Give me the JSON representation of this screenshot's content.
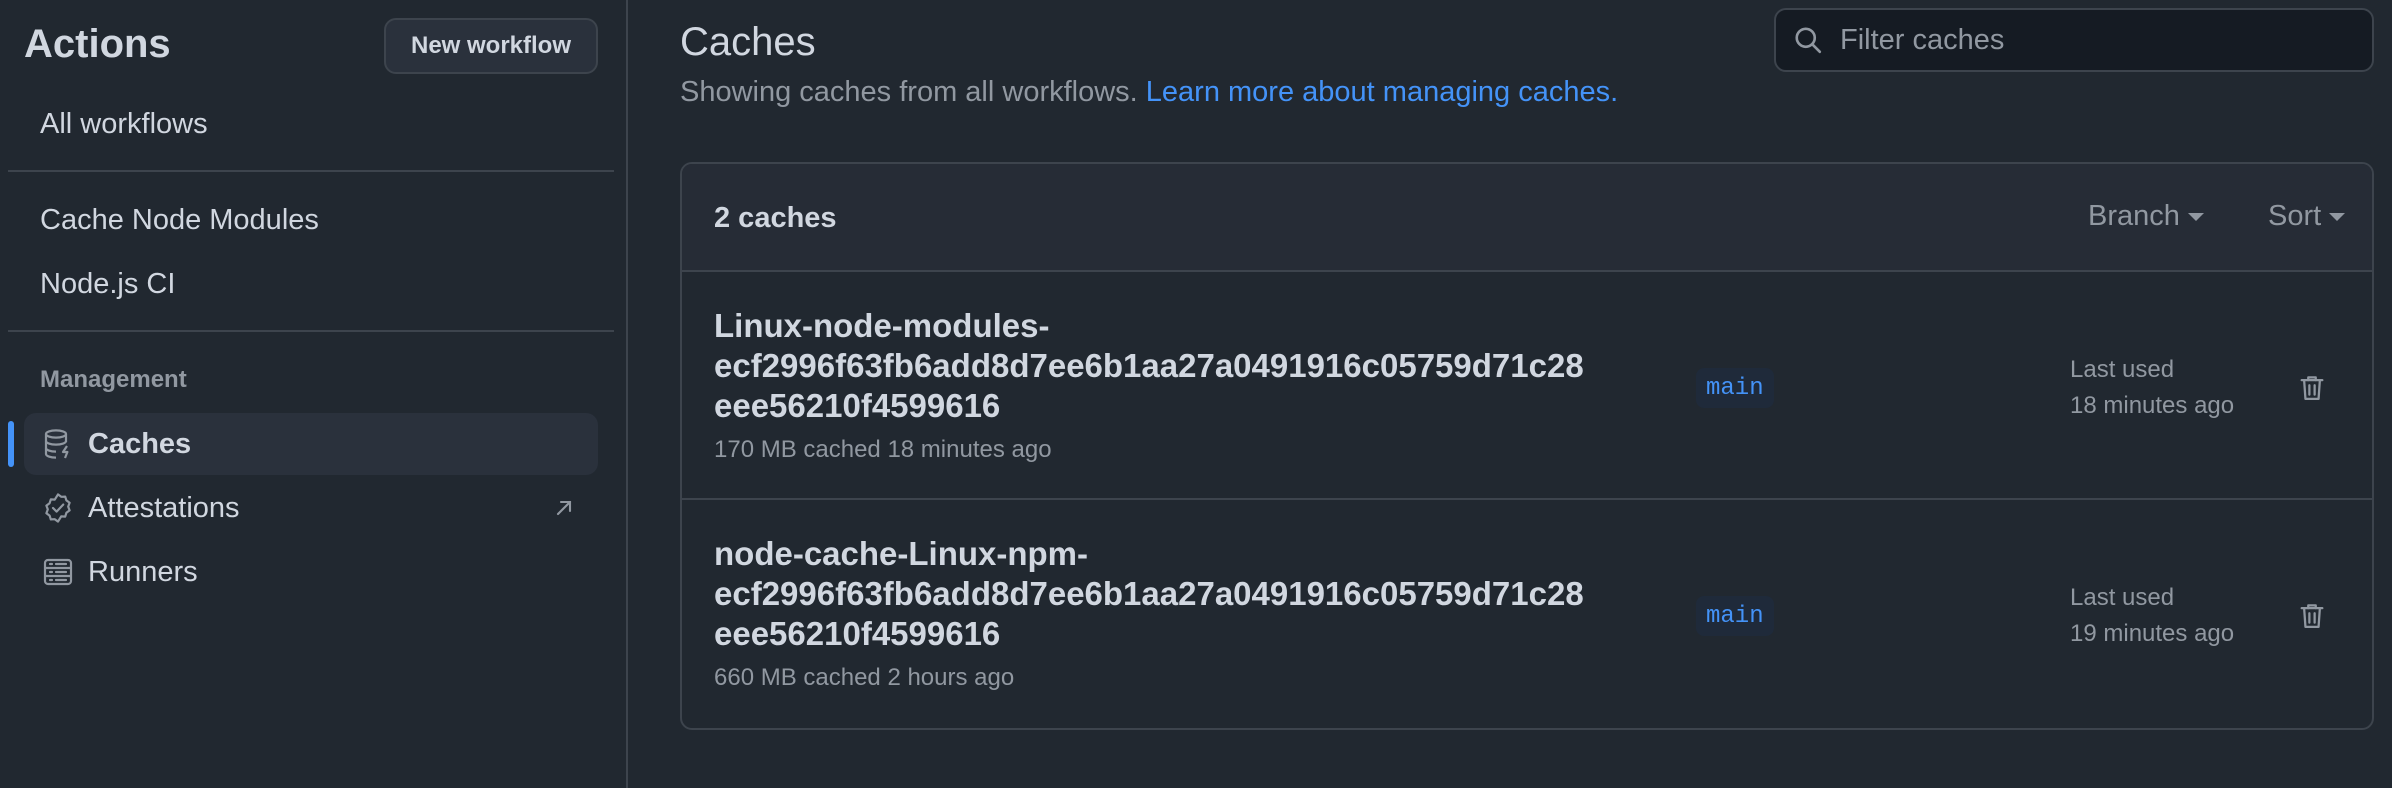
{
  "sidebar": {
    "title": "Actions",
    "new_workflow_label": "New workflow",
    "all_workflows": "All workflows",
    "workflows": [
      {
        "label": "Cache Node Modules"
      },
      {
        "label": "Node.js CI"
      }
    ],
    "management_label": "Management",
    "management_items": [
      {
        "label": "Caches",
        "icon": "database-icon",
        "active": true
      },
      {
        "label": "Attestations",
        "icon": "verified-icon",
        "external": true
      },
      {
        "label": "Runners",
        "icon": "server-icon"
      }
    ]
  },
  "main": {
    "title": "Caches",
    "subtitle": "Showing caches from all workflows.",
    "subtitle_link": "Learn more about managing caches.",
    "filter_placeholder": "Filter caches",
    "count_label": "2 caches",
    "branch_filter": "Branch",
    "sort_filter": "Sort",
    "caches": [
      {
        "key": "Linux-node-modules-ecf2996f63fb6add8d7ee6b1aa27a0491916c05759d71c28eee56210f4599616",
        "key_lines": [
          "Linux-node-modules-",
          "ecf2996f63fb6add8d7ee6b1aa27a0491916c05759d71c28",
          "eee56210f4599616"
        ],
        "meta": "170 MB cached 18 minutes ago",
        "branch": "main",
        "last_used_label": "Last used",
        "last_used_time": "18 minutes ago"
      },
      {
        "key": "node-cache-Linux-npm-ecf2996f63fb6add8d7ee6b1aa27a0491916c05759d71c28eee56210f4599616",
        "key_lines": [
          "node-cache-Linux-npm-",
          "ecf2996f63fb6add8d7ee6b1aa27a0491916c05759d71c28",
          "eee56210f4599616"
        ],
        "meta": "660 MB cached 2 hours ago",
        "branch": "main",
        "last_used_label": "Last used",
        "last_used_time": "19 minutes ago"
      }
    ]
  },
  "colors": {
    "background": "#212830",
    "accent": "#4493f8",
    "border": "#3d444d",
    "muted_text": "#9198a1"
  }
}
